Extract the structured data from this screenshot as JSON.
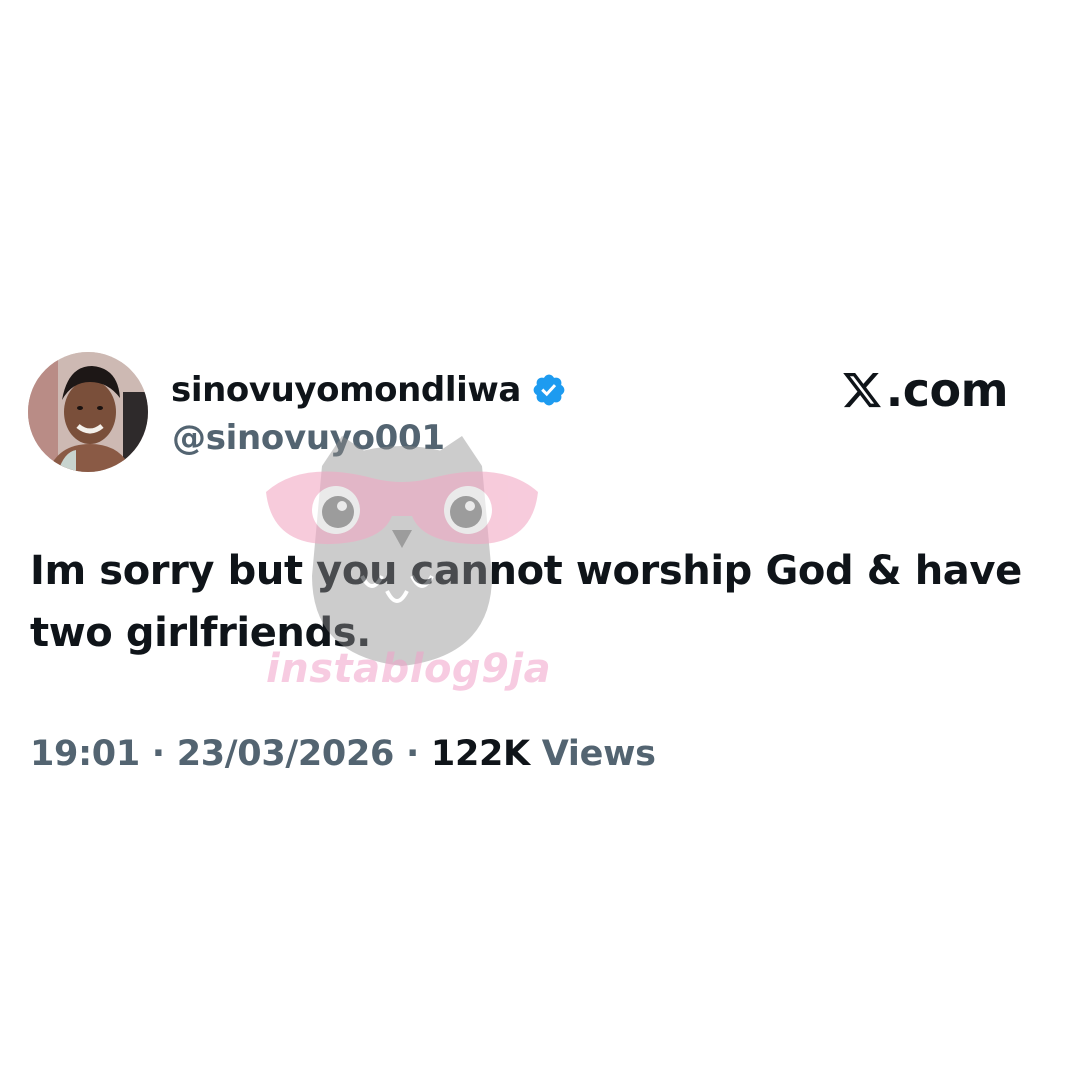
{
  "author": {
    "display_name": "sinovuyomondliwa",
    "handle": "@sinovuyo001",
    "verified": true
  },
  "brand": {
    "logo_icon": "x-logo-icon",
    "text": ".com"
  },
  "tweet": {
    "text": "Im sorry but you cannot worship God & have two girlfriends."
  },
  "meta": {
    "time": "19:01",
    "separator": " · ",
    "date": "23/03/2026",
    "views_count": "122K",
    "views_label": " Views"
  },
  "watermark": {
    "text": "instablog9ja"
  },
  "colors": {
    "text_primary": "#0f1419",
    "text_secondary": "#536471",
    "verified_blue": "#1d9bf0",
    "watermark_pink": "#f0a0c8",
    "watermark_gray": "#9a9a9a"
  }
}
